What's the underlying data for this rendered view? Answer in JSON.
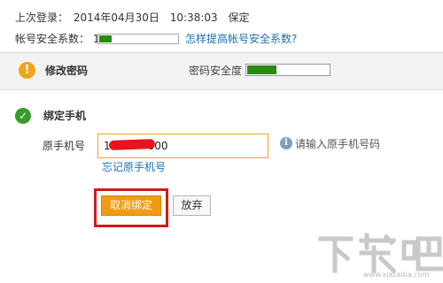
{
  "account": {
    "last_login_label": "上次登录：",
    "last_login_date": "2014年04月30日",
    "last_login_time": "10:38:03",
    "last_login_status": "保定",
    "security_label": "帐号安全系数：",
    "security_value": "1",
    "security_level_fraction": 0.15,
    "help_link": "怎样提高帐号安全系数?"
  },
  "password_section": {
    "icon": "warning-icon",
    "title": "修改密码",
    "strength_label": "密码安全度",
    "strength_fraction": 0.35
  },
  "bind_phone": {
    "icon": "check-icon",
    "title": "绑定手机",
    "phone_label": "原手机号",
    "phone_value": "15         600",
    "phone_hint": "请输入原手机号码",
    "forgot_link": "忘记原手机号",
    "unbind_button": "取消绑定",
    "abandon_button": "放弃"
  },
  "watermark": {
    "logo_text": "下载吧",
    "url": "www.xiazaiba.com"
  },
  "colors": {
    "accent_orange": "#f29b12",
    "link_blue": "#1a6fb5",
    "bar_green": "#2a8a12",
    "highlight_red": "#d21919"
  }
}
